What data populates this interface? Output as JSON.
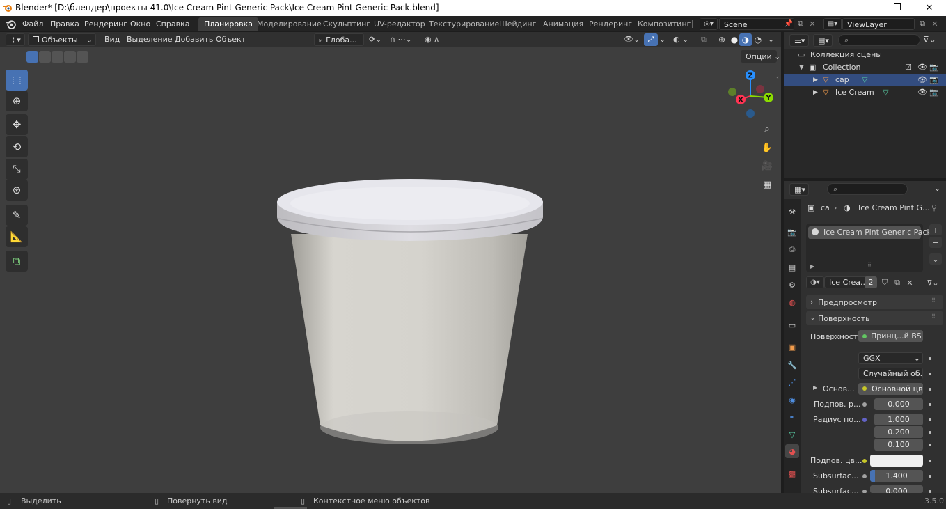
{
  "window": {
    "title": "Blender* [D:\\блендер\\проекты 41.0\\Ice Cream Pint Generic Pack\\Ice Cream Pint Generic Pack.blend]",
    "controls": [
      "—",
      "❐",
      "✕"
    ]
  },
  "menu": {
    "items": [
      "Файл",
      "Правка",
      "Рендеринг",
      "Окно",
      "Справка"
    ]
  },
  "workspaces": {
    "tabs": [
      "Планировка",
      "Моделирование",
      "Скульптинг",
      "UV-редактор",
      "Текстурирование",
      "Шейдинг",
      "Анимация",
      "Рендеринг",
      "Композитинг"
    ],
    "active": "Планировка"
  },
  "scene": {
    "name": "Scene",
    "view_layer": "ViewLayer"
  },
  "viewport": {
    "mode": "Объекты",
    "menus": [
      "Вид",
      "Выделение",
      "Добавить",
      "Объект"
    ],
    "transform_orientation": "Глоба...",
    "options_label": "Опции",
    "gizmo_axes": {
      "x": "X",
      "y": "Y",
      "z": "Z"
    },
    "colors": {
      "x": "#ff3352",
      "y": "#8bdc00",
      "z": "#2890ff",
      "active_tool": "#4772b3"
    }
  },
  "outliner": {
    "root": "Коллекция сцены",
    "collection": "Collection",
    "objects": [
      {
        "name": "cap",
        "selected": true
      },
      {
        "name": "Ice Cream",
        "selected": false
      }
    ]
  },
  "properties": {
    "breadcrumb": {
      "object": "ca",
      "material": "Ice Cream Pint G..."
    },
    "material_slot": "Ice Cream Pint Generic Pack",
    "material_name": "Ice Crea...",
    "user_count": "2",
    "panels": {
      "preview": "Предпросмотр",
      "surface": "Поверхность"
    },
    "surface_label": "Поверхность",
    "surface_shader": "Принц...й BSDF",
    "distribution": "GGX",
    "subsurface_method": "Случайный об...",
    "rows": [
      {
        "label": "Основ...",
        "value": "Основной цвет"
      },
      {
        "label": "Подпов. р...",
        "value": "0.000"
      },
      {
        "label": "Радиус по...",
        "values": [
          "1.000",
          "0.200",
          "0.100"
        ]
      },
      {
        "label": "Подпов. цв...",
        "value": ""
      },
      {
        "label": "Subsurfac...",
        "value": "1.400"
      },
      {
        "label": "Subsurfac...",
        "value": "0.000"
      }
    ]
  },
  "statusbar": {
    "items": [
      "Выделить",
      "Повернуть вид",
      "Контекстное меню объектов"
    ],
    "version": "3.5.0"
  }
}
